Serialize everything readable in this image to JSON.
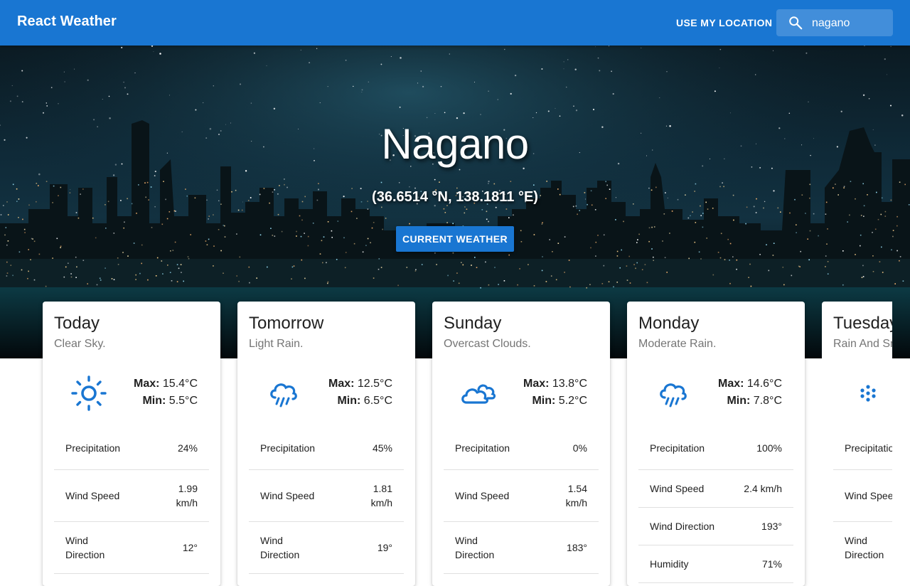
{
  "appbar": {
    "title": "React Weather",
    "location_button": "USE MY LOCATION",
    "search_value": "nagano",
    "search_icon": "search-icon"
  },
  "hero": {
    "city": "Nagano",
    "coords": "(36.6514 °N, 138.1811 °E)",
    "current_button": "CURRENT WEATHER"
  },
  "labels": {
    "max": "Max:",
    "min": "Min:",
    "precipitation": "Precipitation",
    "wind_speed": "Wind Speed",
    "wind_direction": "Wind Direction",
    "humidity": "Humidity"
  },
  "forecast": [
    {
      "day": "Today",
      "desc": "Clear Sky.",
      "icon": "sun-icon",
      "max": "15.4°C",
      "min": "5.5°C",
      "precipitation": "24%",
      "wind_speed": "1.99 km/h",
      "wind_direction": "12°"
    },
    {
      "day": "Tomorrow",
      "desc": "Light Rain.",
      "icon": "rain-cloud-icon",
      "max": "12.5°C",
      "min": "6.5°C",
      "precipitation": "45%",
      "wind_speed": "1.81 km/h",
      "wind_direction": "19°"
    },
    {
      "day": "Sunday",
      "desc": "Overcast Clouds.",
      "icon": "clouds-icon",
      "max": "13.8°C",
      "min": "5.2°C",
      "precipitation": "0%",
      "wind_speed": "1.54 km/h",
      "wind_direction": "183°"
    },
    {
      "day": "Monday",
      "desc": "Moderate Rain.",
      "icon": "rain-cloud-icon",
      "max": "14.6°C",
      "min": "7.8°C",
      "precipitation": "100%",
      "wind_speed": "2.4 km/h",
      "wind_direction": "193°",
      "humidity": "71%"
    },
    {
      "day": "Tuesday",
      "desc": "Rain And Snow.",
      "icon": "snow-icon",
      "precipitation": "",
      "wind_speed": "",
      "wind_direction": ""
    }
  ],
  "colors": {
    "primary": "#1976d2",
    "secondary_text": "#757575"
  }
}
